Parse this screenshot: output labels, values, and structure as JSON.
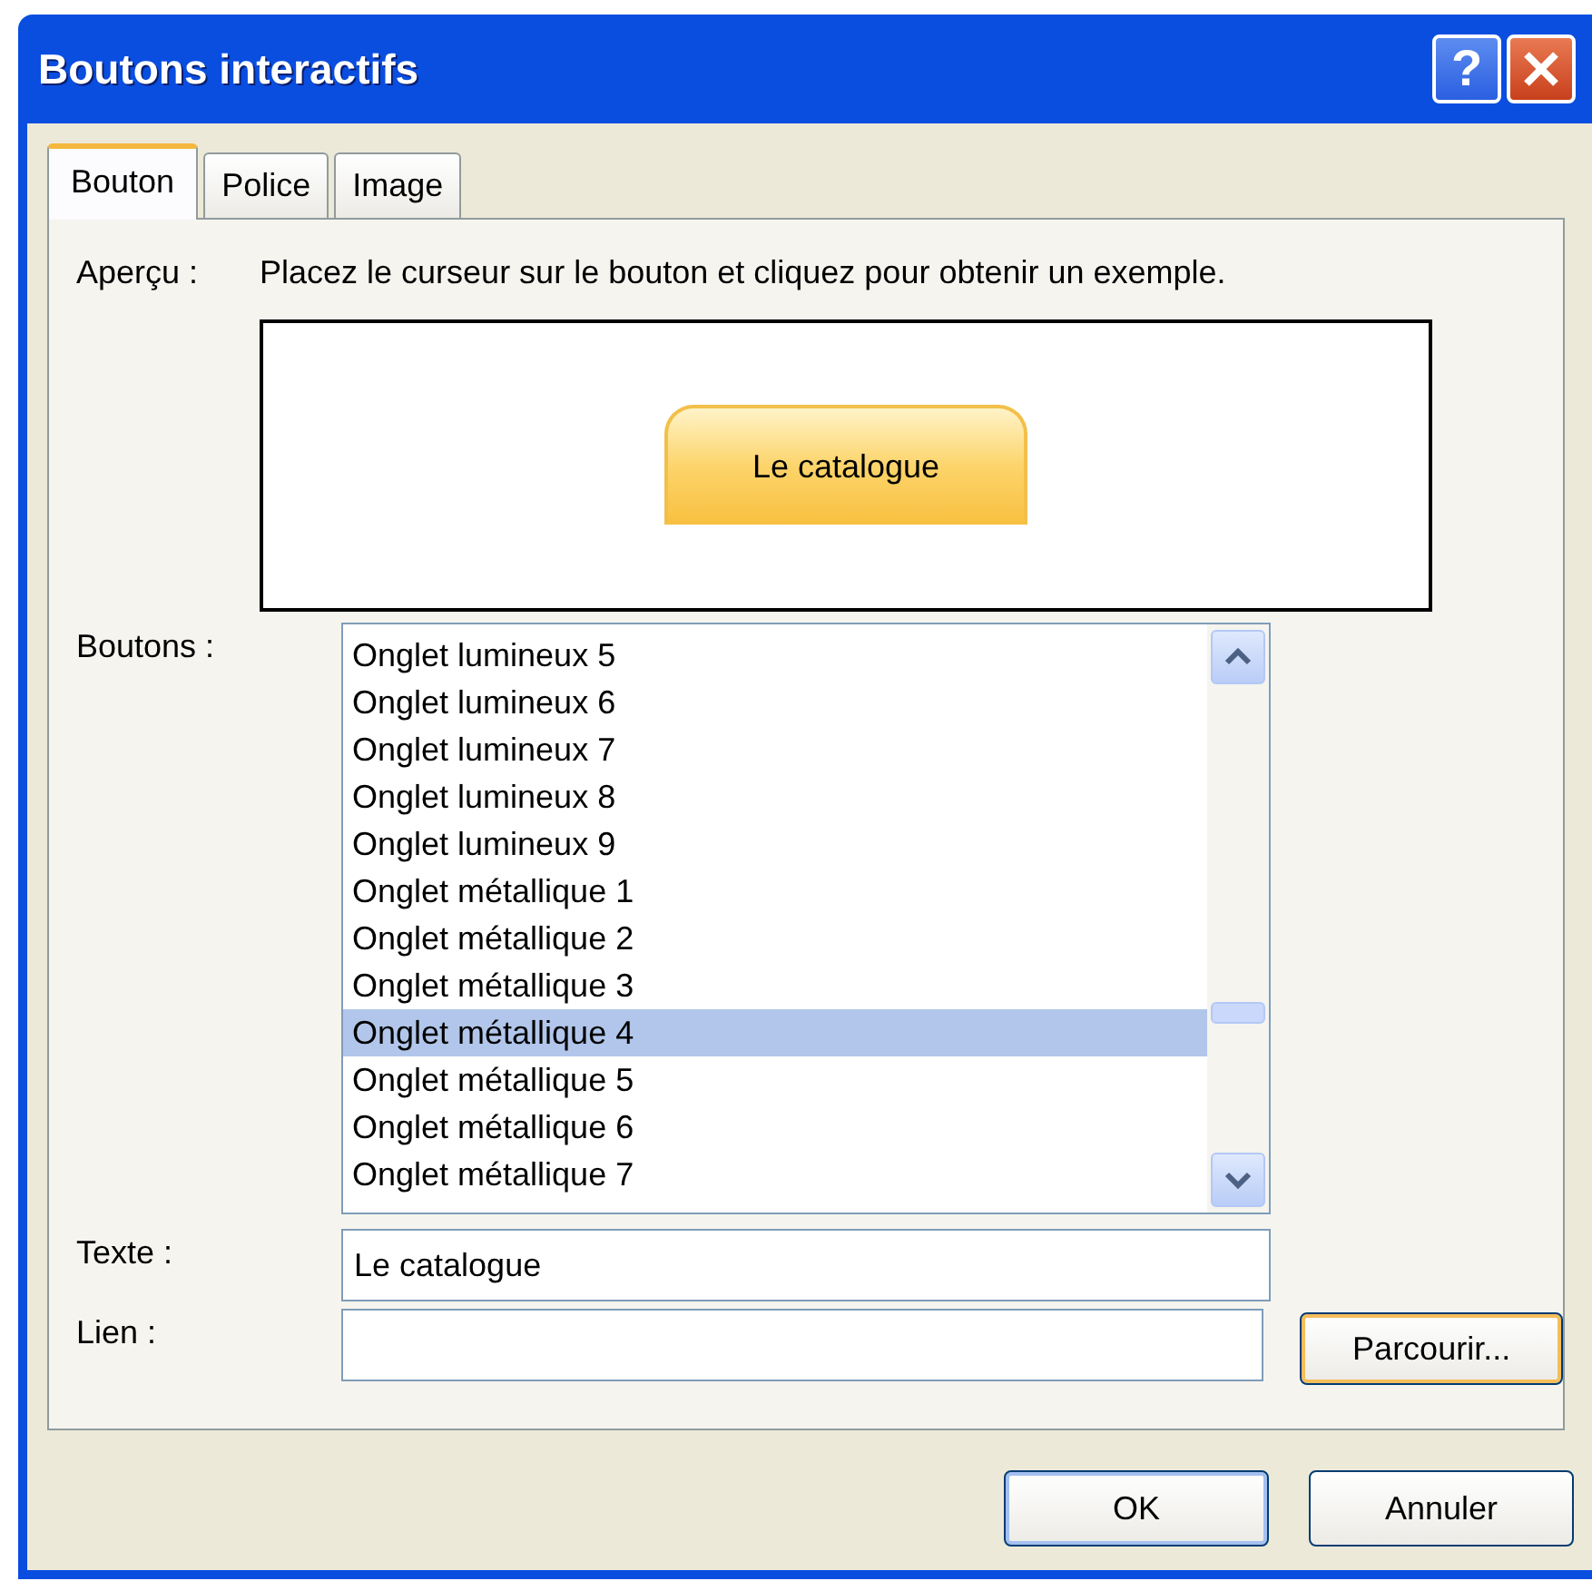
{
  "window": {
    "title": "Boutons interactifs",
    "controls": [
      {
        "kind": "help",
        "label": "?"
      },
      {
        "kind": "close"
      }
    ]
  },
  "tabs": [
    {
      "label": "Bouton",
      "selected": true
    },
    {
      "label": "Police",
      "selected": false
    },
    {
      "label": "Image",
      "selected": false
    }
  ],
  "preview": {
    "label": "Aperçu :",
    "hint": "Placez le curseur sur le bouton et cliquez pour obtenir un exemple.",
    "button_text": "Le catalogue"
  },
  "buttons_list": {
    "label": "Boutons :",
    "items": [
      {
        "text": "Onglet lumineux 5",
        "selected": false
      },
      {
        "text": "Onglet lumineux 6",
        "selected": false
      },
      {
        "text": "Onglet lumineux 7",
        "selected": false
      },
      {
        "text": "Onglet lumineux 8",
        "selected": false
      },
      {
        "text": "Onglet lumineux 9",
        "selected": false
      },
      {
        "text": "Onglet métallique 1",
        "selected": false
      },
      {
        "text": "Onglet métallique 2",
        "selected": false
      },
      {
        "text": "Onglet métallique 3",
        "selected": false
      },
      {
        "text": "Onglet métallique 4",
        "selected": true
      },
      {
        "text": "Onglet métallique 5",
        "selected": false
      },
      {
        "text": "Onglet métallique 6",
        "selected": false
      },
      {
        "text": "Onglet métallique 7",
        "selected": false
      }
    ]
  },
  "text_field": {
    "label": "Texte :",
    "value": "Le catalogue"
  },
  "link_field": {
    "label": "Lien :",
    "browse_button": "Parcourir..."
  },
  "footer_buttons": [
    {
      "label": "OK",
      "default": true
    },
    {
      "label": "Annuler",
      "default": false
    }
  ]
}
